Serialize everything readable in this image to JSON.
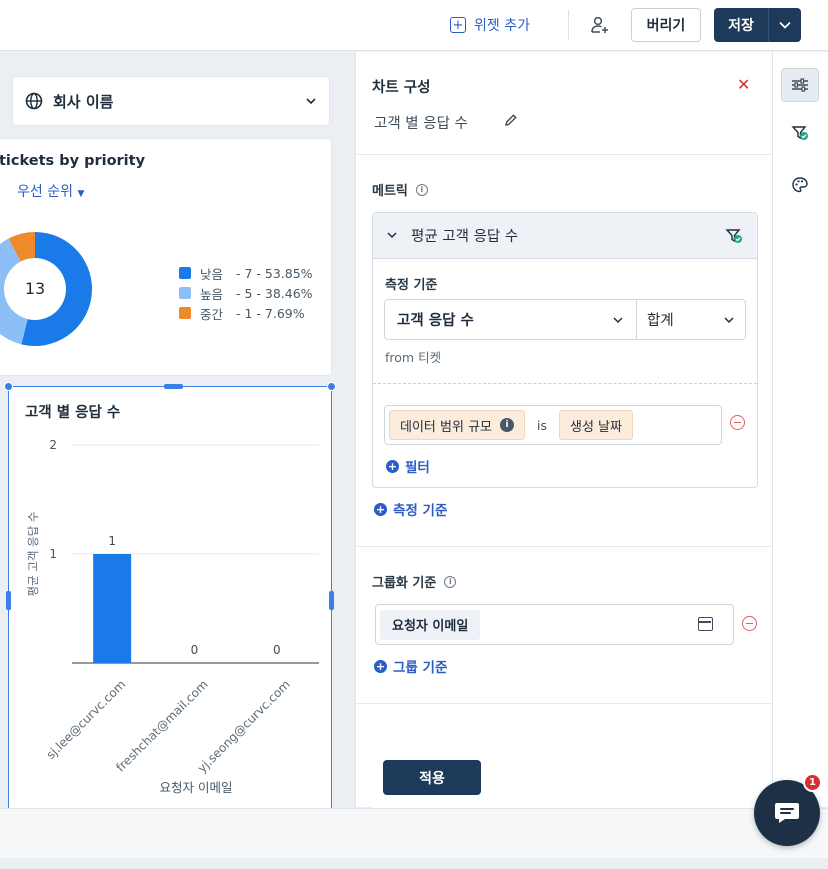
{
  "topbar": {
    "add_widget_label": "위젯 추가",
    "discard_label": "버리기",
    "save_label": "저장"
  },
  "filter": {
    "company_label": "회사 이름"
  },
  "ticket_card": {
    "title": "tickets by priority",
    "group_by_label": "우선 순위",
    "center_total": "13",
    "legend": [
      {
        "name": "낮음",
        "text": "- 7 - 53.85%",
        "color": "#1a7ae8"
      },
      {
        "name": "높음",
        "text": "- 5 - 38.46%",
        "color": "#8dbff7"
      },
      {
        "name": "중간",
        "text": "- 1 - 7.69%",
        "color": "#ee8a2a"
      }
    ]
  },
  "chart_data": {
    "type": "bar",
    "title": "고객 별 응답 수",
    "xlabel": "요청자 이메일",
    "ylabel": "평균 고객 응답 수",
    "categories": [
      "sj.lee@curvc.com",
      "freshchat@mail.com",
      "yj.seong@curvc.com"
    ],
    "values": [
      1,
      0,
      0
    ],
    "yticks": [
      1,
      2
    ],
    "ylim": [
      0,
      2
    ],
    "bar_color": "#1a7ae8",
    "grid": true
  },
  "panel": {
    "title": "차트 구성",
    "chart_name": "고객 별 응답 수",
    "metric_section": "메트릭",
    "metric_name": "평균 고객 응답 수",
    "measure_label": "측정 기준",
    "measure_field": "고객 응답 수",
    "aggregation": "합계",
    "from_label": "from 티켓",
    "filter_chip_1": "데이터 범위 규모",
    "filter_is": "is",
    "filter_chip_2": "생성 날짜",
    "add_filter": "필터",
    "add_measure": "측정 기준",
    "group_section": "그룹화 기준",
    "group_field": "요청자 이메일",
    "add_group": "그룹 기준",
    "apply_label": "적용"
  },
  "chat": {
    "badge_count": "1"
  }
}
